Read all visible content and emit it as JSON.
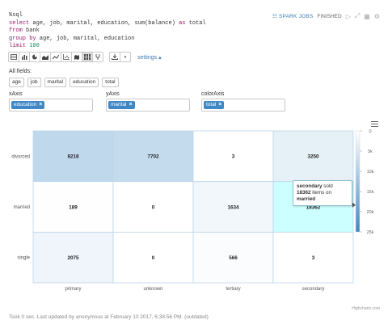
{
  "code": {
    "line1": "%sql",
    "line2_kw": "select",
    "line2_rest": " age, job, marital, education, sum(balance) ",
    "line2_as": "as",
    "line2_end": " total",
    "line3_kw": "from",
    "line3_rest": " bank",
    "line4_kw": "group by",
    "line4_rest": " age, job, marital, education",
    "line5_kw": "limit",
    "line5_num": "100"
  },
  "status": {
    "spark_jobs": "SPARK JOBS",
    "state": "FINISHED"
  },
  "toolbar": {
    "settings_label": "settings",
    "settings_caret": "▴"
  },
  "fields": {
    "label": "All fields:",
    "items": [
      "age",
      "job",
      "marital",
      "education",
      "total"
    ]
  },
  "axes": {
    "x_label": "xAxis",
    "x_value": "education",
    "y_label": "yAxis",
    "y_value": "marital",
    "color_label": "colorAxis",
    "color_value": "total"
  },
  "chart_data": {
    "type": "heatmap",
    "x_categories": [
      "primary",
      "unknown",
      "tertiary",
      "secondary"
    ],
    "y_categories": [
      "divorced",
      "married",
      "single"
    ],
    "values": [
      [
        8218,
        7702,
        3,
        3250
      ],
      [
        189,
        0,
        1634,
        18362
      ],
      [
        2075,
        0,
        566,
        3
      ]
    ],
    "color_axis": {
      "min": 0,
      "max": 25000,
      "tick_labels": [
        "0",
        "5k",
        "10k",
        "15k",
        "20k",
        "25k"
      ],
      "min_color": "#ffffff",
      "max_color": "#3f88c5",
      "hover_color": "#ccffff"
    },
    "highlighted": {
      "x": "secondary",
      "y": "married"
    }
  },
  "tooltip": {
    "x_value": "secondary",
    "sold_text": " sold",
    "count": "18362",
    "items_text": " items on",
    "y_value": "married"
  },
  "credit": "Highcharts.com",
  "footer": "Took 0 sec. Last updated by anonymous at February 10 2017, 6:38:56 PM. (outdated)"
}
